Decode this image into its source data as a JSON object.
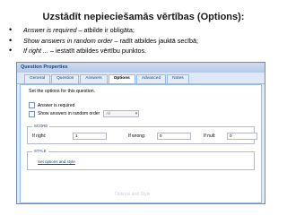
{
  "slide": {
    "title": "Uzstādīt nepieciešamās vērtības (Options):",
    "bullets": [
      {
        "em": "Answer is required",
        "rest": " – atbilde ir obligāta;"
      },
      {
        "em": "Show answers in random order",
        "rest": " – radīt atbildes jauktā secībā;"
      },
      {
        "em": "If right ...",
        "rest": " – iestatīt atbildes vērtību punktos."
      }
    ]
  },
  "dialog": {
    "title": "Question Properties",
    "tabs": [
      "General",
      "Question",
      "Answers",
      "Options",
      "Advanced",
      "Notes"
    ],
    "active_tab": "Options",
    "intro": "Set the options for this question.",
    "answer_required": {
      "label": "Answer is required",
      "checked": false
    },
    "random_order": {
      "label": "Show answers in random order",
      "checked": false,
      "select_value": "All"
    },
    "score": {
      "legend": "SCORE",
      "if_right_label": "If right:",
      "if_right_value": "1",
      "if_wrong_label": "If wrong:",
      "if_wrong_value": "0",
      "if_null_label": "If null:",
      "if_null_value": "0"
    },
    "style": {
      "legend": "STYLE",
      "link": "Set options and style"
    },
    "faded_footer": "Options and Style"
  }
}
